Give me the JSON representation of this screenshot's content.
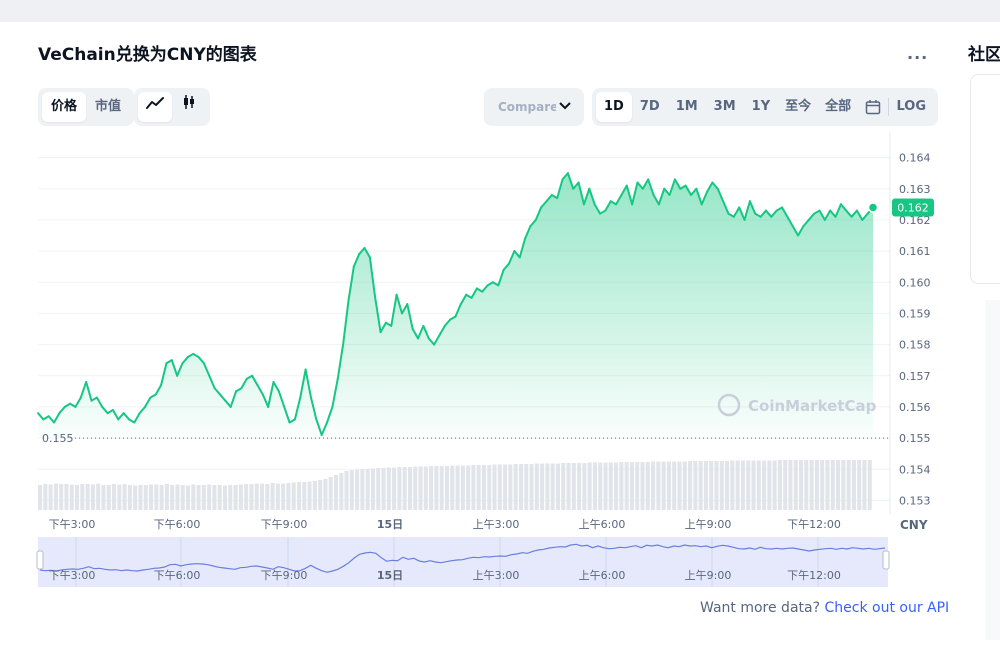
{
  "page_title": "VeChain兑换为CNY的图表",
  "more_label": "...",
  "toggle_type": {
    "price": "价格",
    "market_cap": "市值"
  },
  "compare_placeholder": "Compare with",
  "time_ranges": [
    "1D",
    "7D",
    "1M",
    "3M",
    "1Y",
    "至今",
    "全部"
  ],
  "active_range": "1D",
  "log_label": "LOG",
  "sidebar_title": "社区",
  "footer": {
    "prefix": "Want more data?",
    "link": "Check out our API"
  },
  "watermark": "CoinMarketCap",
  "colors": {
    "line": "#16c784",
    "down": "#ea3943",
    "accent": "#3861fb"
  },
  "chart_data": {
    "type": "area",
    "y_unit": "CNY",
    "ylim": [
      0.1525,
      0.1645
    ],
    "yticks": [
      0.153,
      0.154,
      0.155,
      0.156,
      0.157,
      0.158,
      0.159,
      0.16,
      0.161,
      0.162,
      0.163,
      0.164
    ],
    "ytick_labels": [
      "0.153",
      "0.154",
      "0.155",
      "0.156",
      "0.157",
      "0.158",
      "0.159",
      "0.160",
      "0.161",
      "0.162",
      "0.163",
      "0.164"
    ],
    "xtick_labels": [
      "下午3:00",
      "下午6:00",
      "下午9:00",
      "15日",
      "上午3:00",
      "上午6:00",
      "上午9:00",
      "下午12:00"
    ],
    "open_price": 0.155,
    "open_label": "0.155",
    "current_price": 0.1624,
    "current_label": "0.162",
    "points": [
      [
        0,
        0.1558
      ],
      [
        1,
        0.1556
      ],
      [
        2,
        0.1557
      ],
      [
        3,
        0.1555
      ],
      [
        4,
        0.1558
      ],
      [
        5,
        0.156
      ],
      [
        6,
        0.1561
      ],
      [
        7,
        0.156
      ],
      [
        8,
        0.1563
      ],
      [
        9,
        0.1568
      ],
      [
        10,
        0.1562
      ],
      [
        11,
        0.1563
      ],
      [
        12,
        0.156
      ],
      [
        13,
        0.1558
      ],
      [
        14,
        0.1559
      ],
      [
        15,
        0.1556
      ],
      [
        16,
        0.1558
      ],
      [
        17,
        0.1556
      ],
      [
        18,
        0.1555
      ],
      [
        19,
        0.1558
      ],
      [
        20,
        0.156
      ],
      [
        21,
        0.1563
      ],
      [
        22,
        0.1564
      ],
      [
        23,
        0.1567
      ],
      [
        24,
        0.1574
      ],
      [
        25,
        0.1575
      ],
      [
        26,
        0.157
      ],
      [
        27,
        0.1574
      ],
      [
        28,
        0.1576
      ],
      [
        29,
        0.1577
      ],
      [
        30,
        0.1576
      ],
      [
        31,
        0.1574
      ],
      [
        32,
        0.157
      ],
      [
        33,
        0.1566
      ],
      [
        34,
        0.1564
      ],
      [
        35,
        0.1562
      ],
      [
        36,
        0.156
      ],
      [
        37,
        0.1565
      ],
      [
        38,
        0.1566
      ],
      [
        39,
        0.1569
      ],
      [
        40,
        0.157
      ],
      [
        41,
        0.1567
      ],
      [
        42,
        0.1564
      ],
      [
        43,
        0.156
      ],
      [
        44,
        0.1568
      ],
      [
        45,
        0.1565
      ],
      [
        46,
        0.156
      ],
      [
        47,
        0.1555
      ],
      [
        48,
        0.1556
      ],
      [
        49,
        0.1563
      ],
      [
        50,
        0.1572
      ],
      [
        51,
        0.1563
      ],
      [
        52,
        0.1556
      ],
      [
        53,
        0.1551
      ],
      [
        54,
        0.1555
      ],
      [
        55,
        0.156
      ],
      [
        56,
        0.1569
      ],
      [
        57,
        0.158
      ],
      [
        58,
        0.1594
      ],
      [
        59,
        0.1605
      ],
      [
        60,
        0.1609
      ],
      [
        61,
        0.1611
      ],
      [
        62,
        0.1608
      ],
      [
        63,
        0.1595
      ],
      [
        64,
        0.1584
      ],
      [
        65,
        0.1587
      ],
      [
        66,
        0.1586
      ],
      [
        67,
        0.1596
      ],
      [
        68,
        0.159
      ],
      [
        69,
        0.1593
      ],
      [
        70,
        0.1585
      ],
      [
        71,
        0.1582
      ],
      [
        72,
        0.1586
      ],
      [
        73,
        0.1582
      ],
      [
        74,
        0.158
      ],
      [
        75,
        0.1583
      ],
      [
        76,
        0.1586
      ],
      [
        77,
        0.1588
      ],
      [
        78,
        0.1589
      ],
      [
        79,
        0.1593
      ],
      [
        80,
        0.1596
      ],
      [
        81,
        0.1595
      ],
      [
        82,
        0.1598
      ],
      [
        83,
        0.1597
      ],
      [
        84,
        0.1599
      ],
      [
        85,
        0.16
      ],
      [
        86,
        0.1599
      ],
      [
        87,
        0.1604
      ],
      [
        88,
        0.1606
      ],
      [
        89,
        0.161
      ],
      [
        90,
        0.1608
      ],
      [
        91,
        0.1614
      ],
      [
        92,
        0.1618
      ],
      [
        93,
        0.162
      ],
      [
        94,
        0.1624
      ],
      [
        95,
        0.1626
      ],
      [
        96,
        0.1628
      ],
      [
        97,
        0.1627
      ],
      [
        98,
        0.1633
      ],
      [
        99,
        0.1635
      ],
      [
        100,
        0.163
      ],
      [
        101,
        0.1632
      ],
      [
        102,
        0.1625
      ],
      [
        103,
        0.163
      ],
      [
        104,
        0.1625
      ],
      [
        105,
        0.1622
      ],
      [
        106,
        0.1623
      ],
      [
        107,
        0.1626
      ],
      [
        108,
        0.1625
      ],
      [
        109,
        0.1628
      ],
      [
        110,
        0.1631
      ],
      [
        111,
        0.1625
      ],
      [
        112,
        0.1632
      ],
      [
        113,
        0.163
      ],
      [
        114,
        0.1633
      ],
      [
        115,
        0.1628
      ],
      [
        116,
        0.1625
      ],
      [
        117,
        0.163
      ],
      [
        118,
        0.1628
      ],
      [
        119,
        0.1633
      ],
      [
        120,
        0.163
      ],
      [
        121,
        0.1631
      ],
      [
        122,
        0.1628
      ],
      [
        123,
        0.163
      ],
      [
        124,
        0.1625
      ],
      [
        125,
        0.1629
      ],
      [
        126,
        0.1632
      ],
      [
        127,
        0.163
      ],
      [
        128,
        0.1626
      ],
      [
        129,
        0.1622
      ],
      [
        130,
        0.1621
      ],
      [
        131,
        0.1624
      ],
      [
        132,
        0.162
      ],
      [
        133,
        0.1626
      ],
      [
        134,
        0.1622
      ],
      [
        135,
        0.1621
      ],
      [
        136,
        0.1623
      ],
      [
        137,
        0.1621
      ],
      [
        138,
        0.1623
      ],
      [
        139,
        0.1624
      ],
      [
        140,
        0.1621
      ],
      [
        141,
        0.1618
      ],
      [
        142,
        0.1615
      ],
      [
        143,
        0.1618
      ],
      [
        144,
        0.162
      ],
      [
        145,
        0.1622
      ],
      [
        146,
        0.1623
      ],
      [
        147,
        0.162
      ],
      [
        148,
        0.1623
      ],
      [
        149,
        0.1621
      ],
      [
        150,
        0.1625
      ],
      [
        151,
        0.1623
      ],
      [
        152,
        0.1621
      ],
      [
        153,
        0.1623
      ],
      [
        154,
        0.162
      ],
      [
        155,
        0.1622
      ],
      [
        156,
        0.1624
      ]
    ],
    "volume": [
      0.5,
      0.52,
      0.51,
      0.53,
      0.52,
      0.52,
      0.51,
      0.5,
      0.52,
      0.52,
      0.51,
      0.53,
      0.5,
      0.5,
      0.52,
      0.51,
      0.52,
      0.5,
      0.49,
      0.5,
      0.5,
      0.51,
      0.51,
      0.5,
      0.52,
      0.5,
      0.51,
      0.5,
      0.49,
      0.51,
      0.5,
      0.5,
      0.51,
      0.5,
      0.5,
      0.49,
      0.5,
      0.5,
      0.51,
      0.52,
      0.52,
      0.53,
      0.53,
      0.52,
      0.54,
      0.53,
      0.53,
      0.54,
      0.55,
      0.56,
      0.56,
      0.57,
      0.58,
      0.6,
      0.62,
      0.66,
      0.7,
      0.74,
      0.78,
      0.8,
      0.81,
      0.82,
      0.82,
      0.83,
      0.84,
      0.84,
      0.85,
      0.85,
      0.86,
      0.86,
      0.86,
      0.87,
      0.87,
      0.87,
      0.88,
      0.88,
      0.88,
      0.88,
      0.89,
      0.89,
      0.89,
      0.89,
      0.9,
      0.9,
      0.9,
      0.9,
      0.91,
      0.91,
      0.91,
      0.91,
      0.92,
      0.92,
      0.92,
      0.92,
      0.93,
      0.93,
      0.93,
      0.93,
      0.93,
      0.94,
      0.94,
      0.94,
      0.94,
      0.94,
      0.95,
      0.95,
      0.95,
      0.95,
      0.95,
      0.95,
      0.96,
      0.96,
      0.96,
      0.96,
      0.96,
      0.96,
      0.97,
      0.97,
      0.97,
      0.97,
      0.97,
      0.97,
      0.97,
      0.98,
      0.98,
      0.98,
      0.98,
      0.98,
      0.98,
      0.98,
      0.98,
      0.99,
      0.99,
      0.99,
      0.99,
      0.99,
      0.99,
      0.99,
      0.99,
      0.99,
      1.0,
      1.0,
      1.0,
      1.0,
      1.0,
      1.0,
      1.0,
      1.0,
      1.0,
      1.0,
      1.0,
      1.0,
      1.0,
      1.0,
      1.0,
      1.0,
      1.0,
      1.0
    ]
  }
}
